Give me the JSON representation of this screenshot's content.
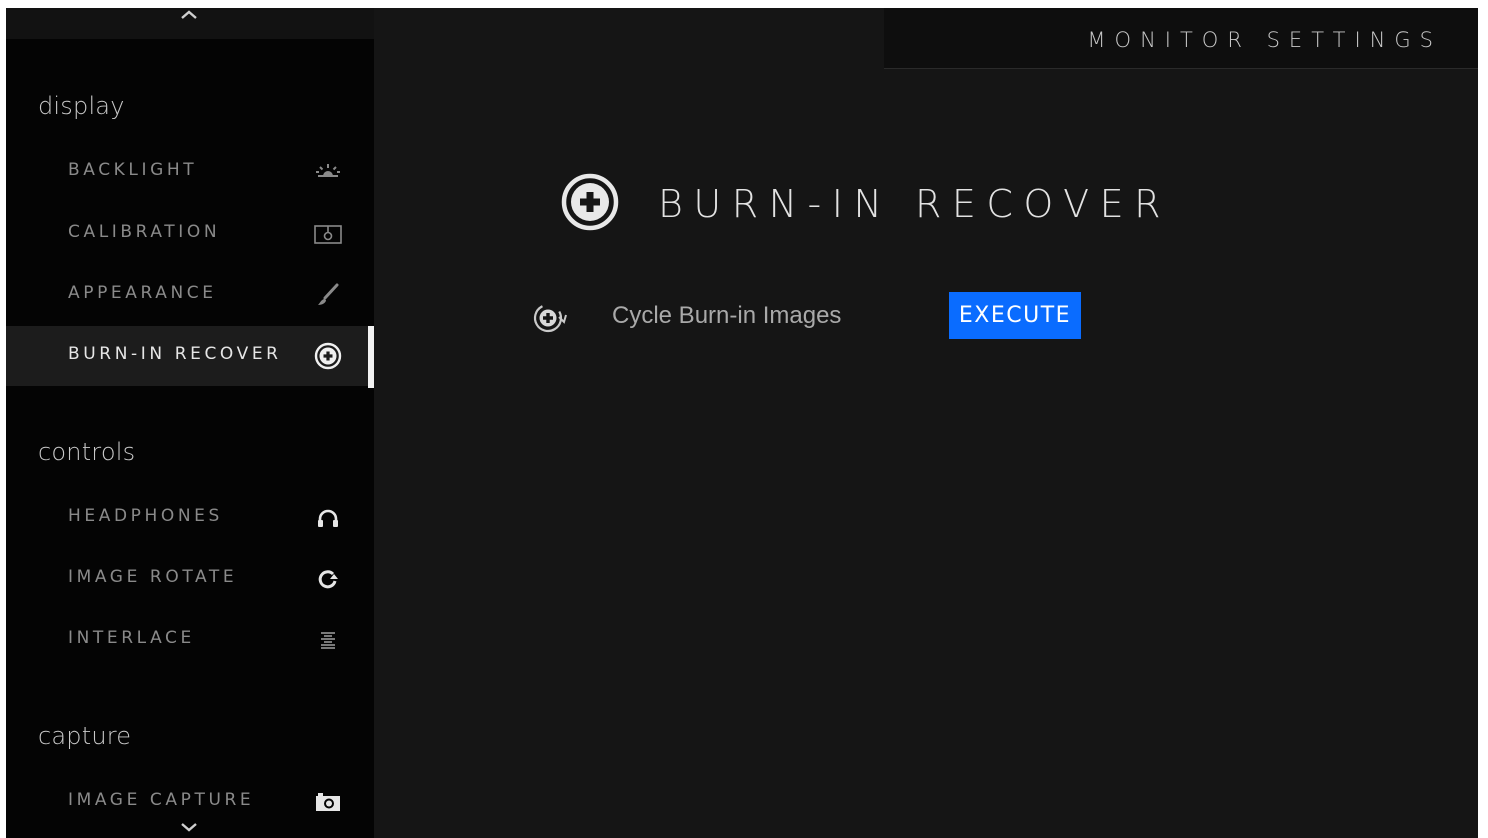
{
  "header": {
    "title": "MONITOR SETTINGS"
  },
  "sidebar": {
    "groups": [
      {
        "title": "display",
        "items": [
          {
            "label": "BACKLIGHT",
            "icon": "backlight-icon"
          },
          {
            "label": "CALIBRATION",
            "icon": "calibration-icon"
          },
          {
            "label": "APPEARANCE",
            "icon": "brush-icon"
          },
          {
            "label": "BURN-IN RECOVER",
            "icon": "plus-circle-icon",
            "active": true
          }
        ]
      },
      {
        "title": "controls",
        "items": [
          {
            "label": "HEADPHONES",
            "icon": "headphones-icon"
          },
          {
            "label": "IMAGE ROTATE",
            "icon": "rotate-icon"
          },
          {
            "label": "INTERLACE",
            "icon": "interlace-icon"
          }
        ]
      },
      {
        "title": "capture",
        "items": [
          {
            "label": "IMAGE CAPTURE",
            "icon": "camera-icon"
          }
        ]
      }
    ]
  },
  "main": {
    "section_title": "BURN-IN RECOVER",
    "rows": [
      {
        "label": "Cycle Burn-in Images",
        "action": "EXECUTE"
      }
    ]
  },
  "colors": {
    "accent": "#0a6cff",
    "background": "#151515",
    "sidebar": "#040404"
  }
}
